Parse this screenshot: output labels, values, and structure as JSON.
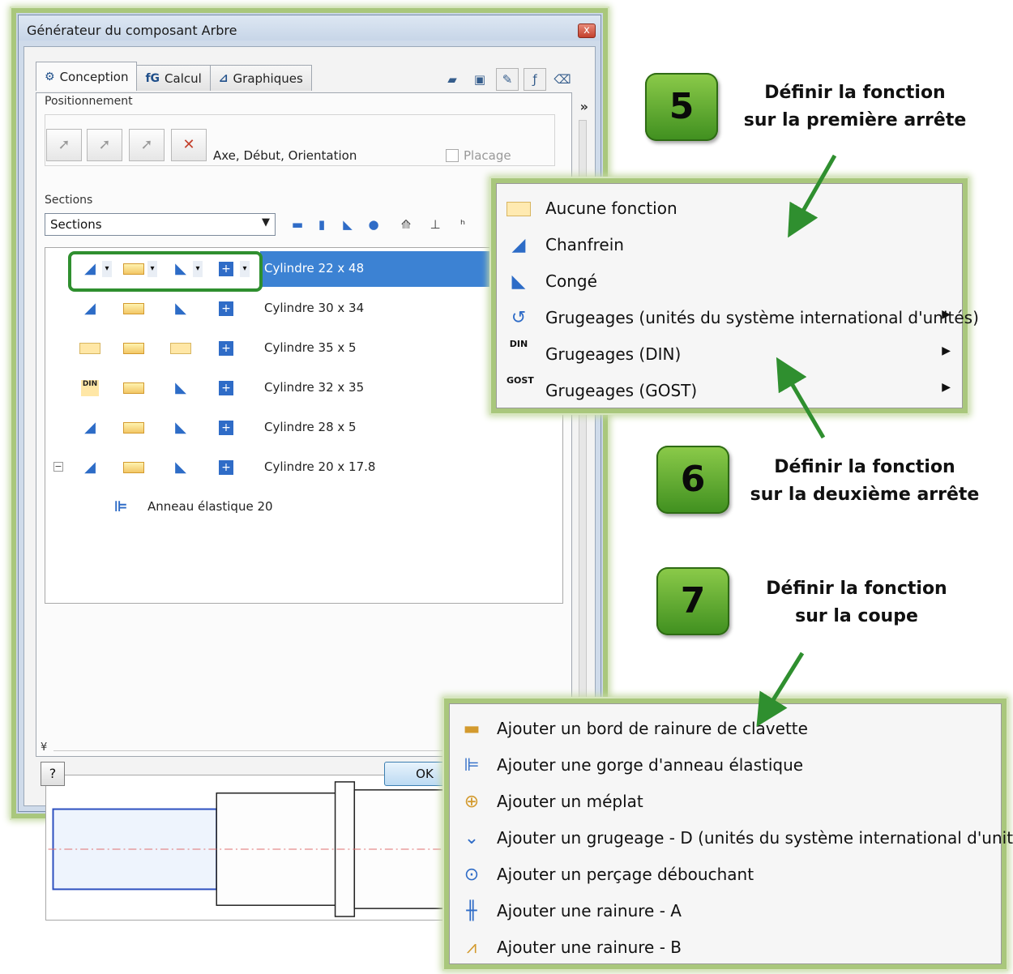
{
  "dialog": {
    "title": "Générateur du composant Arbre",
    "close": "x",
    "tabs": [
      {
        "icon": "⚙",
        "label": "Conception"
      },
      {
        "icon": "fG",
        "label": "Calcul"
      },
      {
        "icon": "⊿",
        "label": "Graphiques"
      }
    ],
    "expand": "»",
    "collapse": "¥",
    "positioning": {
      "label": "Positionnement",
      "axis_label": "Axe, Début, Orientation",
      "placage": "Placage"
    },
    "sections": {
      "label": "Sections",
      "select_value": "Sections"
    },
    "tree": [
      {
        "label": "Cylindre 22 x 48",
        "selected": true
      },
      {
        "label": "Cylindre 30 x 34"
      },
      {
        "label": "Cylindre 35 x 5"
      },
      {
        "label": "Cylindre 32 x 35"
      },
      {
        "label": "Cylindre 28 x 5"
      },
      {
        "label": "Cylindre 20 x 17.8"
      }
    ],
    "tree_child": "Anneau élastique 20",
    "din_tag": "DIN",
    "help": "?",
    "ok": "OK"
  },
  "menu_edge": {
    "items": [
      {
        "label": "Aucune fonction"
      },
      {
        "label": "Chanfrein"
      },
      {
        "label": "Congé"
      },
      {
        "label": "Grugeages (unités du système international d'unités)",
        "submenu": true
      },
      {
        "label": "Grugeages (DIN)",
        "submenu": true,
        "tag": "DIN"
      },
      {
        "label": "Grugeages (GOST)",
        "submenu": true,
        "tag": "GOST"
      }
    ]
  },
  "menu_section": {
    "items": [
      {
        "label": "Ajouter un bord de rainure de clavette"
      },
      {
        "label": "Ajouter une gorge d'anneau élastique"
      },
      {
        "label": "Ajouter un méplat"
      },
      {
        "label": "Ajouter un grugeage - D (unités du système international d'unités)"
      },
      {
        "label": "Ajouter un perçage débouchant"
      },
      {
        "label": "Ajouter une rainure - A"
      },
      {
        "label": "Ajouter une rainure - B"
      }
    ]
  },
  "annotations": [
    {
      "step": "5",
      "line1": "Définir la fonction",
      "line2": "sur la première arrête"
    },
    {
      "step": "6",
      "line1": "Définir la fonction",
      "line2": "sur la deuxième arrête"
    },
    {
      "step": "7",
      "line1": "Définir la fonction",
      "line2": "sur la coupe"
    }
  ],
  "colors": {
    "accent_green": "#2f8f2f",
    "selection_blue": "#3c82d3",
    "glow": "#a9c77c"
  }
}
